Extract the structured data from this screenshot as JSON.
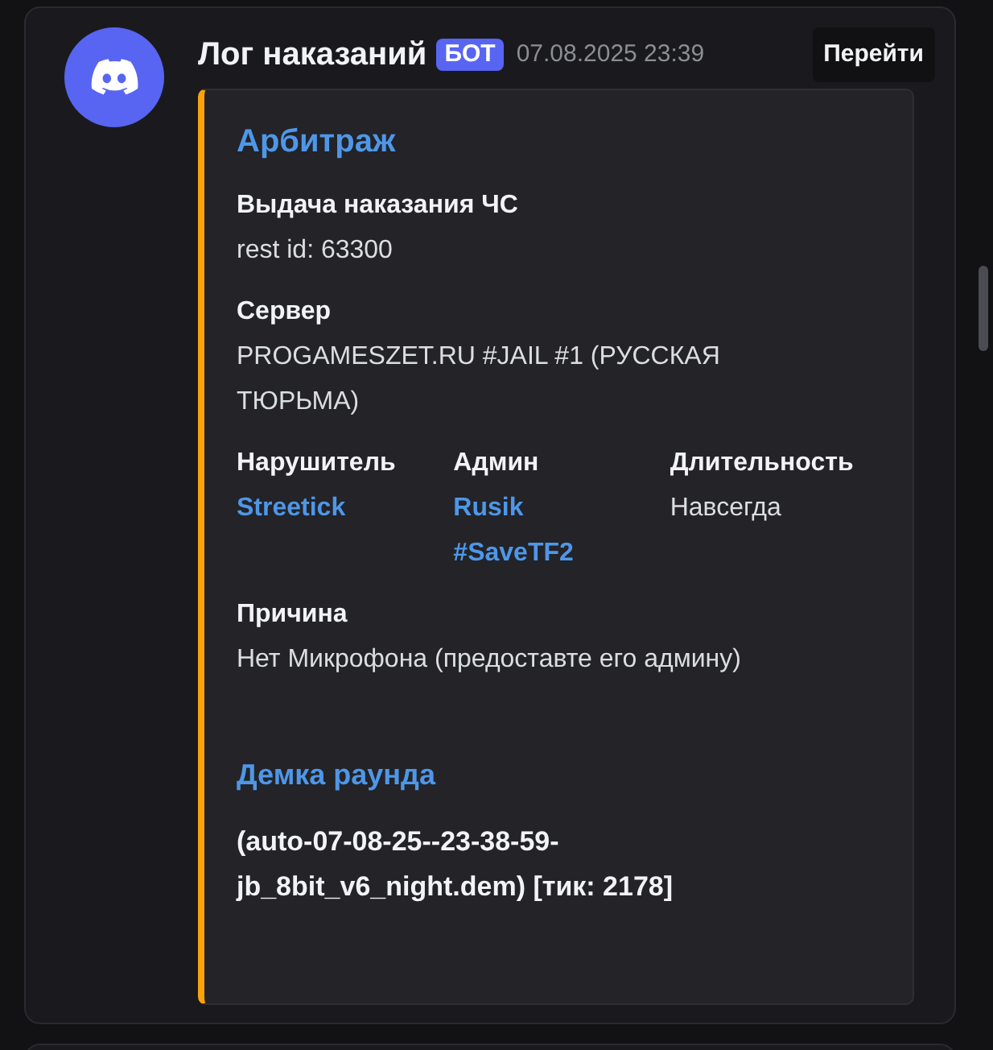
{
  "message": {
    "author": "Лог наказаний",
    "badge": "БОТ",
    "timestamp": "07.08.2025 23:39",
    "action_button": "Перейти"
  },
  "embed": {
    "color": "#f9a20c",
    "title": "Арбитраж",
    "fields": [
      {
        "name": "Выдача наказания ЧС",
        "value": "rest id: 63300",
        "inline": false,
        "kind": "text"
      },
      {
        "name": "Сервер",
        "value": "PROGAMESZET.RU #JAIL #1 (РУССКАЯ ТЮРЬМА)",
        "inline": false,
        "kind": "text"
      },
      {
        "name": "Нарушитель",
        "value": "Streetick",
        "inline": true,
        "kind": "link"
      },
      {
        "name": "Админ",
        "value": "Rusik #SaveTF2",
        "inline": true,
        "kind": "link"
      },
      {
        "name": "Длительность",
        "value": "Навсегда",
        "inline": true,
        "kind": "text"
      },
      {
        "name": "Причина",
        "value": "Нет Микрофона (предоставте его админу)",
        "inline": false,
        "kind": "text"
      }
    ],
    "link_title": "Демка раунда",
    "description": "(auto-07-08-25--23-38-59-jb_8bit_v6_night.dem) [тик: 2178]"
  }
}
